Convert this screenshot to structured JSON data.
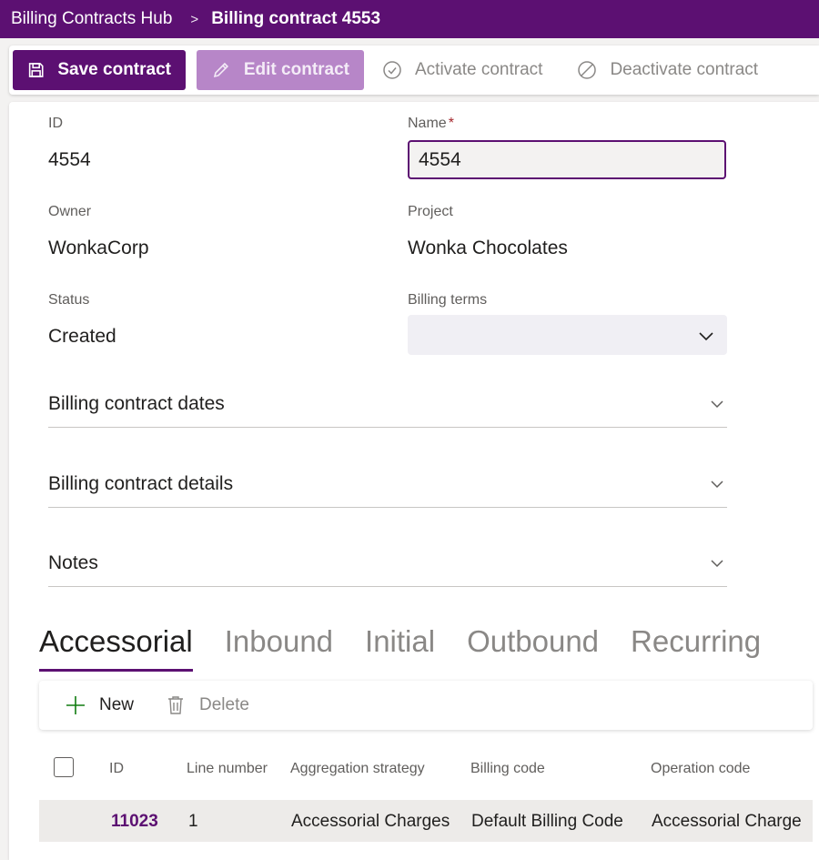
{
  "breadcrumb": {
    "app": "Billing Contracts Hub",
    "separator": ">",
    "current": "Billing contract 4553"
  },
  "toolbar": {
    "save_label": "Save contract",
    "edit_label": "Edit contract",
    "activate_label": "Activate contract",
    "deactivate_label": "Deactivate contract"
  },
  "form": {
    "id_label": "ID",
    "id_value": "4554",
    "name_label": "Name",
    "name_required": "*",
    "name_value": "4554",
    "owner_label": "Owner",
    "owner_value": "WonkaCorp",
    "project_label": "Project",
    "project_value": "Wonka Chocolates",
    "status_label": "Status",
    "status_value": "Created",
    "billing_terms_label": "Billing terms",
    "billing_terms_value": ""
  },
  "sections": [
    {
      "label": "Billing contract dates"
    },
    {
      "label": "Billing contract details"
    },
    {
      "label": "Notes"
    }
  ],
  "tabs": [
    {
      "label": "Accessorial",
      "active": true
    },
    {
      "label": "Inbound",
      "active": false
    },
    {
      "label": "Initial",
      "active": false
    },
    {
      "label": "Outbound",
      "active": false
    },
    {
      "label": "Recurring",
      "active": false
    }
  ],
  "grid_toolbar": {
    "new_label": "New",
    "delete_label": "Delete"
  },
  "grid": {
    "columns": [
      "ID",
      "Line number",
      "Aggregation strategy",
      "Billing code",
      "Operation code"
    ],
    "rows": [
      [
        "11023",
        "1",
        "Accessorial Charges",
        "Default Billing Code",
        "Accessorial Charge"
      ]
    ]
  },
  "colors": {
    "brand": "#5c1072",
    "brand_disabled": "#b786c8",
    "required": "#a4262c",
    "new_icon": "#107c10"
  },
  "icons": {
    "save": "save-icon",
    "edit": "pencil-icon",
    "activate": "check-circle-icon",
    "deactivate": "cancel-circle-icon",
    "new": "plus-icon",
    "delete": "trash-icon",
    "expand": "chevron-down-icon"
  }
}
